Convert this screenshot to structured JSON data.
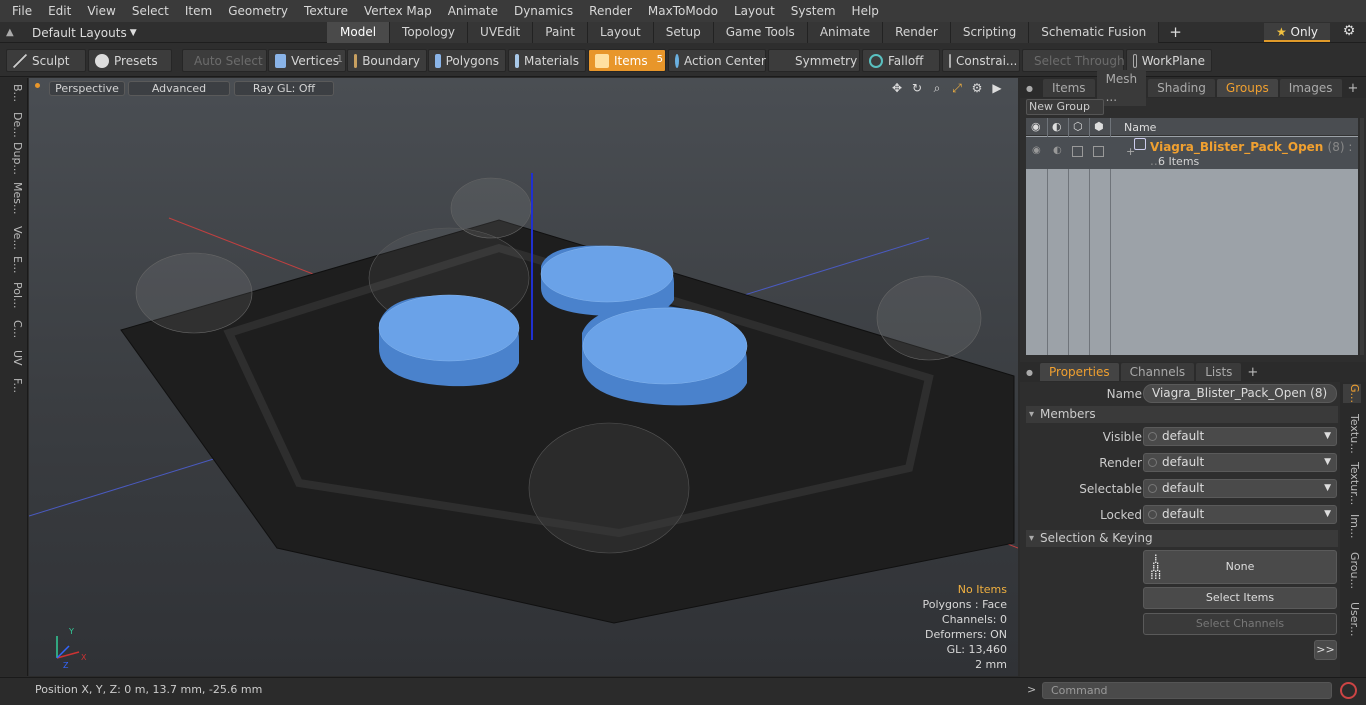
{
  "menu": [
    "File",
    "Edit",
    "View",
    "Select",
    "Item",
    "Geometry",
    "Texture",
    "Vertex Map",
    "Animate",
    "Dynamics",
    "Render",
    "MaxToModo",
    "Layout",
    "System",
    "Help"
  ],
  "layout_selector": "Default Layouts",
  "layout_tabs": [
    "Model",
    "Topology",
    "UVEdit",
    "Paint",
    "Layout",
    "Setup",
    "Game Tools",
    "Animate",
    "Render",
    "Scripting",
    "Schematic Fusion"
  ],
  "active_layout_tab": "Model",
  "only_label": "Only",
  "toolbar": {
    "sculpt": "Sculpt",
    "presets": "Presets",
    "auto_select": "Auto Select",
    "vertices": "Vertices",
    "vertices_count": "1",
    "boundary": "Boundary",
    "polygons": "Polygons",
    "materials": "Materials",
    "items": "Items",
    "items_count": "5",
    "action_center": "Action Center",
    "symmetry": "Symmetry",
    "falloff": "Falloff",
    "constraints": "Constrai...",
    "select_through": "Select Through",
    "workplane": "WorkPlane"
  },
  "left_tabs": [
    "B...",
    "De...",
    "Dup...",
    "Mes...",
    "Ve...",
    "E...",
    "Pol...",
    "C...",
    "UV",
    "F..."
  ],
  "viewport": {
    "view_mode": "Perspective",
    "shading": "Advanced",
    "raygl": "Ray GL: Off",
    "stats": {
      "items": "No Items",
      "polygons": "Polygons : Face",
      "channels": "Channels: 0",
      "deformers": "Deformers: ON",
      "gl": "GL: 13,460",
      "scale": "2 mm"
    },
    "axes": {
      "x": "X",
      "y": "Y",
      "z": "Z"
    }
  },
  "statusbar": "Position X, Y, Z:   0 m, 13.7 mm, -25.6 mm",
  "groups_panel": {
    "tabs": [
      "Items",
      "Mesh ...",
      "Shading",
      "Groups",
      "Images"
    ],
    "active_tab": "Groups",
    "new_group": "New Group",
    "name_header": "Name",
    "group_name": "Viagra_Blister_Pack_Open",
    "group_count": "(8) : ...",
    "group_items": "6 Items"
  },
  "properties": {
    "tabs": [
      "Properties",
      "Channels",
      "Lists"
    ],
    "active_tab": "Properties",
    "name_label": "Name",
    "name_value": "Viagra_Blister_Pack_Open (8)",
    "members_section": "Members",
    "visible_label": "Visible",
    "visible_value": "default",
    "render_label": "Render",
    "render_value": "default",
    "selectable_label": "Selectable",
    "selectable_value": "default",
    "locked_label": "Locked",
    "locked_value": "default",
    "selkey_section": "Selection & Keying",
    "none_label": "None",
    "select_items": "Select Items",
    "select_channels": "Select Channels",
    "more": ">>"
  },
  "right_vtabs": [
    "G...",
    "Textu...",
    "Textur...",
    "Im...",
    "Grou...",
    "User..."
  ],
  "command": {
    "prompt": ">",
    "placeholder": "Command"
  },
  "colors": {
    "accent": "#e8962a",
    "pill": "#6aa2e8",
    "tray": "#1e1e1e"
  }
}
